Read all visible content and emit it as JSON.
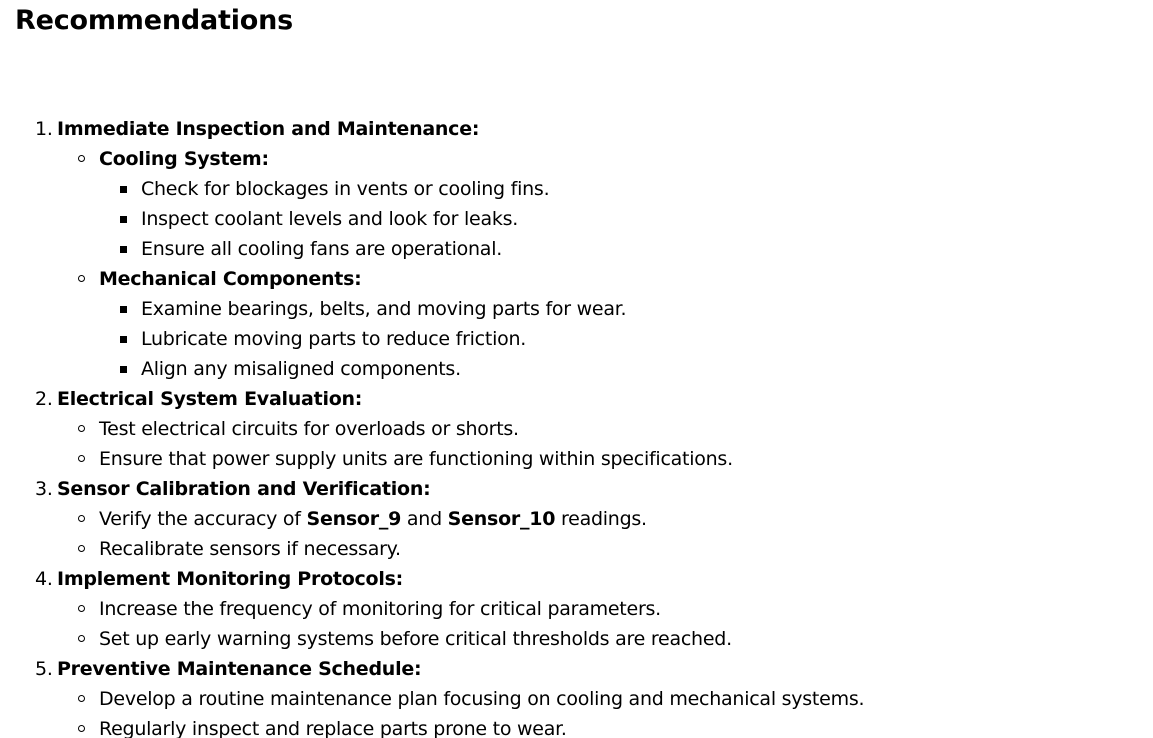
{
  "heading": "Recommendations",
  "items": [
    {
      "number": "1.",
      "title": "Immediate Inspection and Maintenance:",
      "groups": [
        {
          "title": "Cooling System:",
          "points": [
            "Check for blockages in vents or cooling fins.",
            "Inspect coolant levels and look for leaks.",
            "Ensure all cooling fans are operational."
          ]
        },
        {
          "title": "Mechanical Components:",
          "points": [
            "Examine bearings, belts, and moving parts for wear.",
            "Lubricate moving parts to reduce friction.",
            "Align any misaligned components."
          ]
        }
      ]
    },
    {
      "number": "2.",
      "title": "Electrical System Evaluation:",
      "points": [
        "Test electrical circuits for overloads or shorts.",
        "Ensure that power supply units are functioning within specifications."
      ]
    },
    {
      "number": "3.",
      "title": "Sensor Calibration and Verification:",
      "verify": {
        "before": "Verify the accuracy of ",
        "sensor_a": "Sensor_9",
        "middle": " and ",
        "sensor_b": "Sensor_10",
        "after": " readings."
      },
      "points": [
        "Recalibrate sensors if necessary."
      ]
    },
    {
      "number": "4.",
      "title": "Implement Monitoring Protocols:",
      "points": [
        "Increase the frequency of monitoring for critical parameters.",
        "Set up early warning systems before critical thresholds are reached."
      ]
    },
    {
      "number": "5.",
      "title": "Preventive Maintenance Schedule:",
      "points": [
        "Develop a routine maintenance plan focusing on cooling and mechanical systems.",
        "Regularly inspect and replace parts prone to wear."
      ]
    }
  ]
}
